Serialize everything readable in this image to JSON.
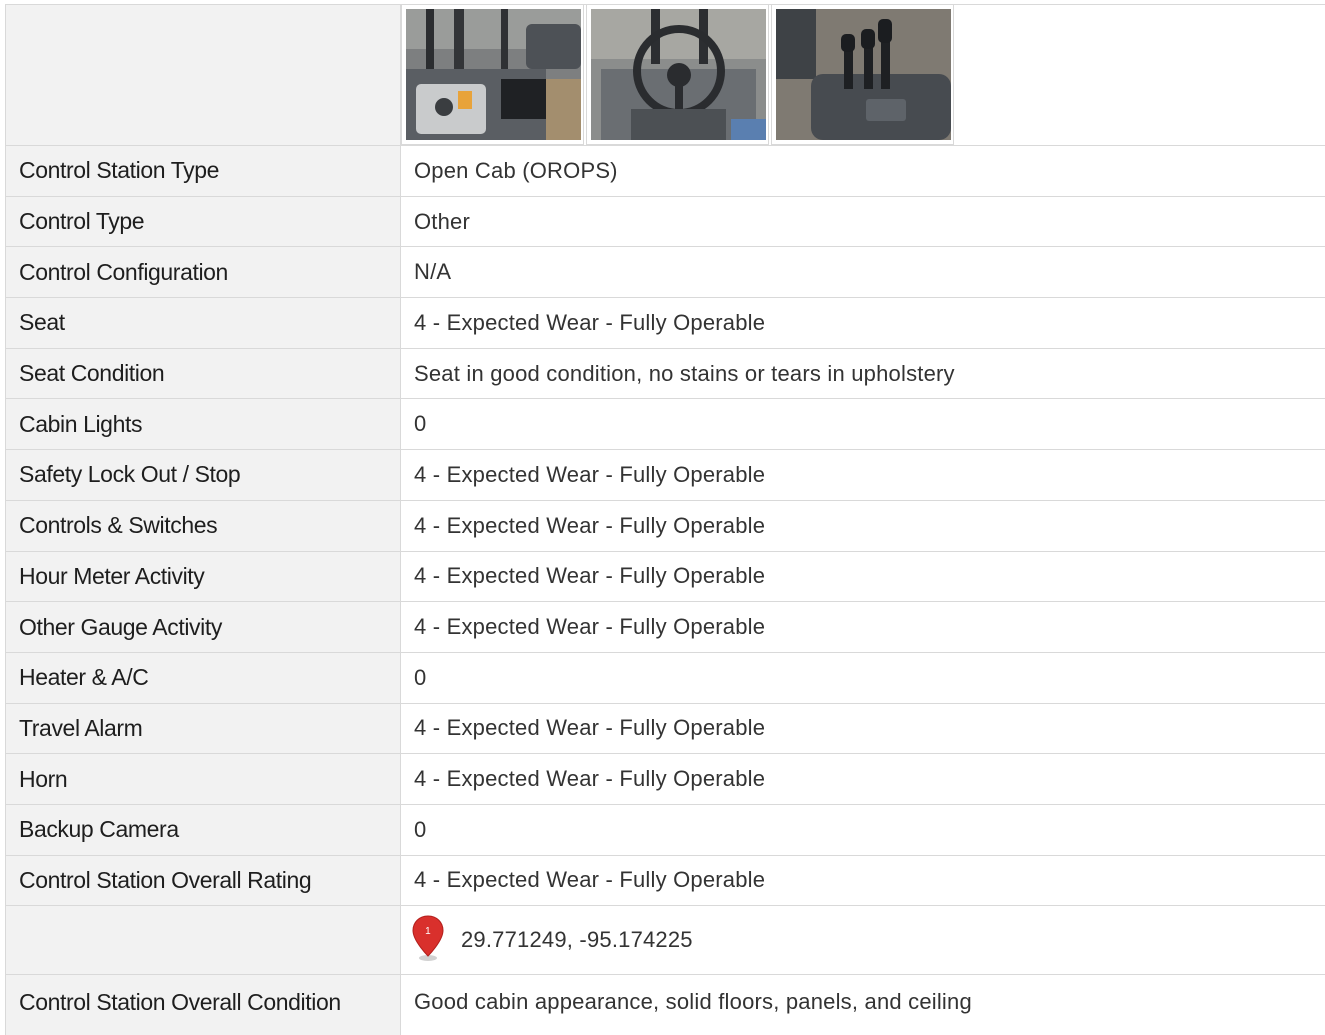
{
  "photos": [
    {
      "icon": "seat-panel-photo-icon"
    },
    {
      "icon": "steering-wheel-photo-icon"
    },
    {
      "icon": "control-levers-photo-icon"
    }
  ],
  "rows": [
    {
      "label": "Control Station Type",
      "value": "Open Cab (OROPS)"
    },
    {
      "label": "Control Type",
      "value": "Other"
    },
    {
      "label": "Control Configuration",
      "value": "N/A"
    },
    {
      "label": "Seat",
      "value": "4 - Expected Wear - Fully Operable"
    },
    {
      "label": "Seat Condition",
      "value": "Seat in good condition, no stains or tears in upholstery"
    },
    {
      "label": "Cabin Lights",
      "value": "0"
    },
    {
      "label": "Safety Lock Out / Stop",
      "value": "4 - Expected Wear - Fully Operable"
    },
    {
      "label": "Controls & Switches",
      "value": "4 - Expected Wear - Fully Operable"
    },
    {
      "label": "Hour Meter Activity",
      "value": "4 - Expected Wear - Fully Operable"
    },
    {
      "label": "Other Gauge Activity",
      "value": "4 - Expected Wear - Fully Operable"
    },
    {
      "label": "Heater & A/C",
      "value": "0"
    },
    {
      "label": "Travel Alarm",
      "value": "4 - Expected Wear - Fully Operable"
    },
    {
      "label": "Horn",
      "value": "4 - Expected Wear - Fully Operable"
    },
    {
      "label": "Backup Camera",
      "value": "0"
    },
    {
      "label": "Control Station Overall Rating",
      "value": "4 - Expected Wear - Fully Operable"
    }
  ],
  "location": {
    "pin_number": "1",
    "pin_color": "#d9302c",
    "coordinates": "29.771249, -95.174225"
  },
  "overall_condition": {
    "label": "Control Station Overall Condition",
    "value": "Good cabin appearance, solid floors, panels, and ceiling"
  }
}
